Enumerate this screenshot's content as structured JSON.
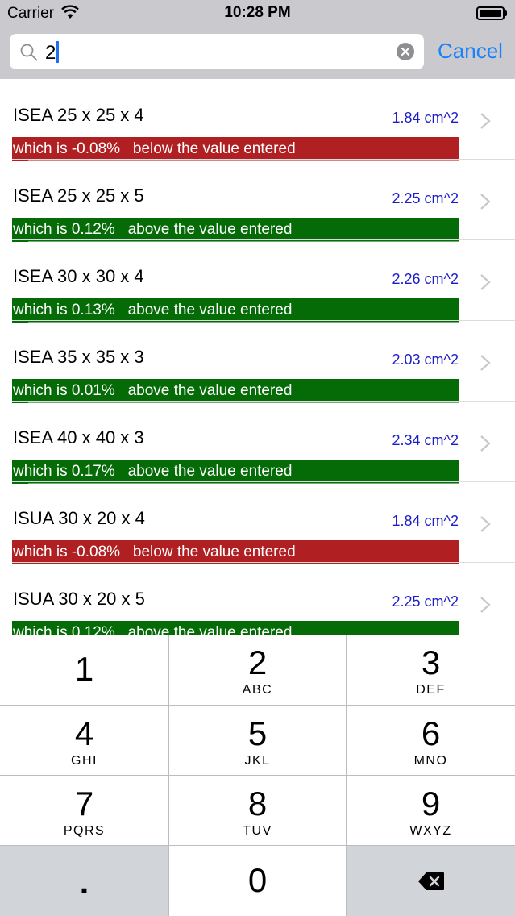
{
  "status_bar": {
    "carrier": "Carrier",
    "time": "10:28 PM"
  },
  "search": {
    "value": "2",
    "cancel_label": "Cancel"
  },
  "colors": {
    "below": "#b01f22",
    "above": "#046b06",
    "accent": "#1a82fb",
    "area_text": "#1c1cc8"
  },
  "results": [
    {
      "name": "ISEA 25 x 25 x 4",
      "area": "1.84 cm^2",
      "diff": "which is -0.08%   below the value entered",
      "direction": "below"
    },
    {
      "name": "ISEA 25 x 25 x 5",
      "area": "2.25 cm^2",
      "diff": "which is 0.12%   above the value entered",
      "direction": "above"
    },
    {
      "name": "ISEA 30 x 30 x 4",
      "area": "2.26 cm^2",
      "diff": "which is 0.13%   above the value entered",
      "direction": "above"
    },
    {
      "name": "ISEA 35 x 35 x 3",
      "area": "2.03 cm^2",
      "diff": "which is 0.01%   above the value entered",
      "direction": "above"
    },
    {
      "name": "ISEA 40 x 40 x 3",
      "area": "2.34 cm^2",
      "diff": "which is 0.17%   above the value entered",
      "direction": "above"
    },
    {
      "name": "ISUA 30 x 20 x 4",
      "area": "1.84 cm^2",
      "diff": "which is -0.08%   below the value entered",
      "direction": "below"
    },
    {
      "name": "ISUA 30 x 20 x 5",
      "area": "2.25 cm^2",
      "diff": "which is 0.12%   above the value entered",
      "direction": "above"
    }
  ],
  "keypad": {
    "keys": [
      {
        "digit": "1",
        "letters": ""
      },
      {
        "digit": "2",
        "letters": "ABC"
      },
      {
        "digit": "3",
        "letters": "DEF"
      },
      {
        "digit": "4",
        "letters": "GHI"
      },
      {
        "digit": "5",
        "letters": "JKL"
      },
      {
        "digit": "6",
        "letters": "MNO"
      },
      {
        "digit": "7",
        "letters": "PQRS"
      },
      {
        "digit": "8",
        "letters": "TUV"
      },
      {
        "digit": "9",
        "letters": "WXYZ"
      }
    ],
    "decimal": ".",
    "zero": "0"
  }
}
